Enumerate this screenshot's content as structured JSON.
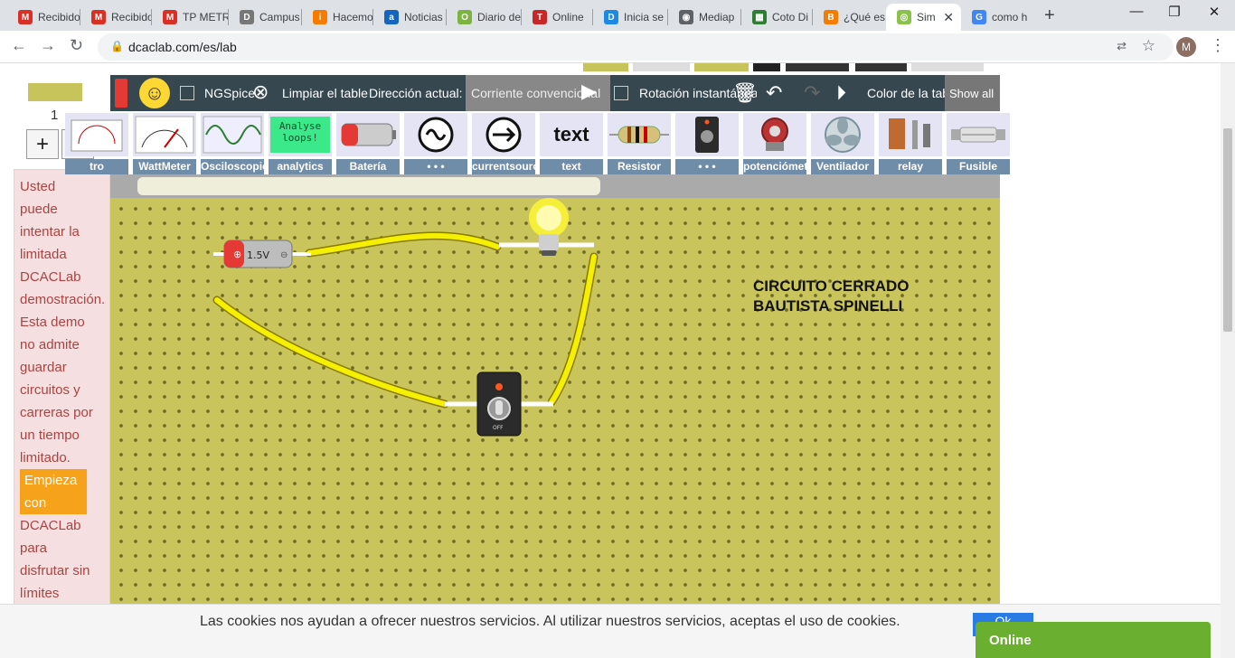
{
  "browser": {
    "tabs": [
      {
        "label": "Recibido",
        "favicon": "gmail-icon",
        "color": "#d93025",
        "glyph": "M"
      },
      {
        "label": "Recibido",
        "favicon": "gmail-icon",
        "color": "#d93025",
        "glyph": "M"
      },
      {
        "label": "TP METR",
        "favicon": "gmail-icon",
        "color": "#d93025",
        "glyph": "M"
      },
      {
        "label": "Campus",
        "favicon": "campus-icon",
        "color": "#777777",
        "glyph": "D"
      },
      {
        "label": "Hacemos",
        "favicon": "info-icon",
        "color": "#f57c00",
        "glyph": "i"
      },
      {
        "label": "Noticias",
        "favicon": "news-icon",
        "color": "#1565c0",
        "glyph": "a"
      },
      {
        "label": "Diario de",
        "favicon": "ole-icon",
        "color": "#7cb342",
        "glyph": "O"
      },
      {
        "label": "Online",
        "favicon": "online-icon",
        "color": "#c62828",
        "glyph": "T"
      },
      {
        "label": "Inicia se",
        "favicon": "d-icon",
        "color": "#1e88e5",
        "glyph": "D"
      },
      {
        "label": "Mediap",
        "favicon": "globe-icon",
        "color": "#5f6368",
        "glyph": "◉"
      },
      {
        "label": "Coto Di",
        "favicon": "coto-icon",
        "color": "#2e7d32",
        "glyph": "▦"
      },
      {
        "label": "¿Qué es",
        "favicon": "blogger-icon",
        "color": "#f57c00",
        "glyph": "B"
      },
      {
        "label": "Sim",
        "favicon": "dcaclab-icon",
        "color": "#8bc34a",
        "glyph": "◎",
        "active": true
      },
      {
        "label": "como h",
        "favicon": "google-icon",
        "color": "#4285f4",
        "glyph": "G"
      }
    ],
    "url": "dcaclab.com/es/lab",
    "avatar_letter": "M"
  },
  "left_panel": {
    "page_count": "1",
    "message_lines": [
      "Usted",
      "puede",
      "intentar la",
      "limitada",
      "DCACLab",
      "demostración.",
      "Esta demo",
      "no admite",
      "guardar",
      "circuitos y",
      "carreras por",
      "un tiempo",
      "limitado."
    ],
    "start_link": "Empieza con",
    "message_after": [
      "DCACLab",
      "para",
      "disfrutar sin",
      "límites"
    ]
  },
  "sim_toolbar": {
    "ngspice": "NGSpice",
    "clear": "Limpiar el tablero",
    "direction": "Dirección actual:",
    "direction_value": "Corriente convencional",
    "rotation": "Rotación instantánea",
    "color": "Color de la tabla",
    "show_all": "Show all"
  },
  "palette": [
    {
      "label": "tro",
      "icon": "meter-icon"
    },
    {
      "label": "WattMeter",
      "icon": "wattmeter-icon"
    },
    {
      "label": "Osciloscopio",
      "icon": "oscilloscope-icon"
    },
    {
      "label": "analytics",
      "icon": "analytics-icon",
      "text": "Analyse\nloops!"
    },
    {
      "label": "Batería",
      "icon": "battery-icon"
    },
    {
      "label": "• • •",
      "icon": "ac-source-icon"
    },
    {
      "label": "currentsource",
      "icon": "current-source-icon"
    },
    {
      "label": "text",
      "icon": "text-icon",
      "text": "text"
    },
    {
      "label": "Resistor",
      "icon": "resistor-icon"
    },
    {
      "label": "• • •",
      "icon": "switch-icon"
    },
    {
      "label": "potenciómetro",
      "icon": "potentiometer-icon"
    },
    {
      "label": "Ventilador",
      "icon": "fan-icon"
    },
    {
      "label": "relay",
      "icon": "relay-icon"
    },
    {
      "label": "Fusible",
      "icon": "fuse-icon"
    }
  ],
  "board": {
    "title_line1": "CIRCUITO CERRADO",
    "title_line2": "BAUTISTA SPINELLI",
    "battery_label": "1.5V",
    "switch_label": "OFF"
  },
  "cookie": {
    "text": "Las cookies nos ayudan a ofrecer nuestros servicios. Al utilizar nuestros servicios, aceptas el uso de cookies.",
    "ok": "Ok"
  },
  "online_label": "Online",
  "colors": {
    "board": "#c9c45c",
    "wire": "#f5f000",
    "toolbar": "#37474f",
    "palette_label": "#6f8ca8",
    "online": "#6aaf2f"
  }
}
